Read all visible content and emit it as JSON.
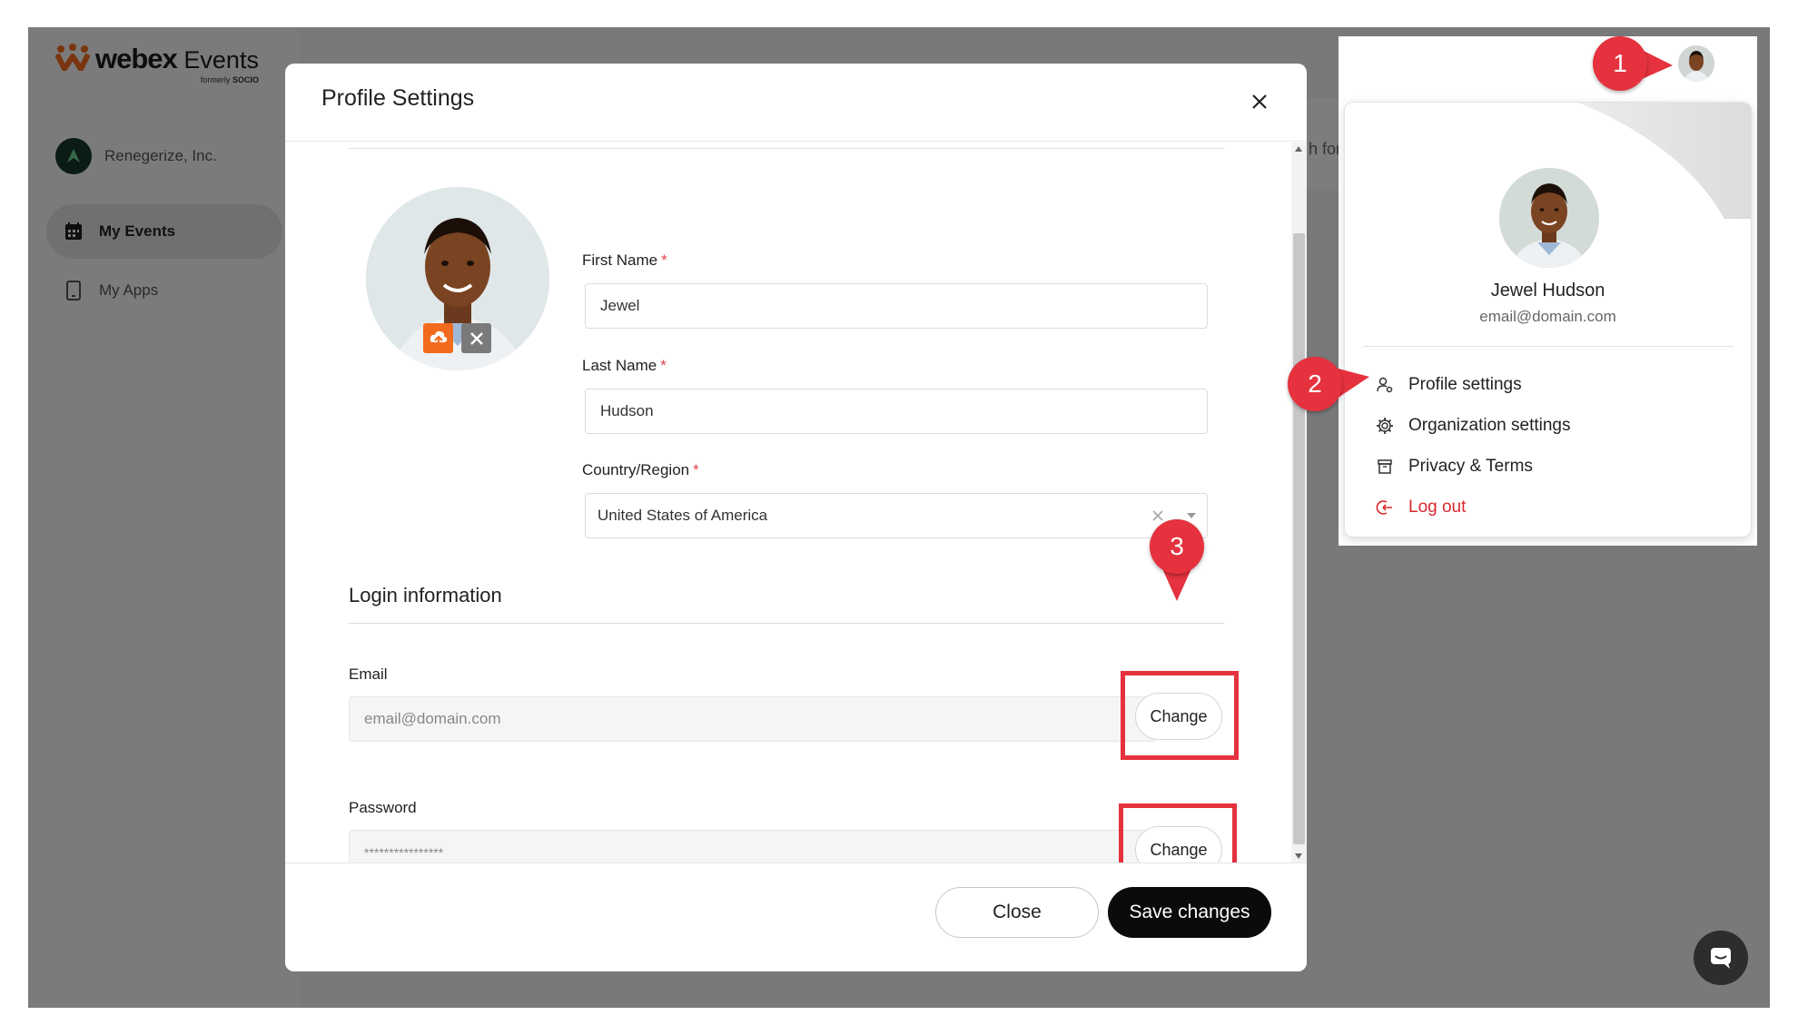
{
  "app": {
    "logo_main": "webex",
    "logo_events": "Events",
    "logo_sub_prefix": "formerly",
    "logo_sub_brand": "SOCIO",
    "org_name": "Renegerize, Inc.",
    "nav": [
      {
        "label": "My Events",
        "icon": "calendar-icon",
        "active": true
      },
      {
        "label": "My Apps",
        "icon": "tablet-icon",
        "active": false
      }
    ],
    "search_ghost": "h for"
  },
  "modal": {
    "title": "Profile Settings",
    "first_name_label": "First Name",
    "first_name_value": "Jewel",
    "last_name_label": "Last Name",
    "last_name_value": "Hudson",
    "country_label": "Country/Region",
    "country_value": "United States of America",
    "required_mark": "*",
    "login_section_title": "Login information",
    "email_label": "Email",
    "email_placeholder": "email@domain.com",
    "password_label": "Password",
    "password_placeholder": "****************",
    "change_label": "Change",
    "close_label": "Close",
    "save_label": "Save changes"
  },
  "user_menu": {
    "name": "Jewel Hudson",
    "email": "email@domain.com",
    "items": [
      {
        "label": "Profile settings",
        "icon": "user-settings-icon"
      },
      {
        "label": "Organization settings",
        "icon": "gear-icon"
      },
      {
        "label": "Privacy & Terms",
        "icon": "archive-icon"
      },
      {
        "label": "Log out",
        "icon": "logout-icon"
      }
    ]
  },
  "callouts": [
    "1",
    "2",
    "3"
  ],
  "colors": {
    "accent_red": "#e5323e",
    "upload_orange": "#f26b1d",
    "primary_dark": "#0b0b0b"
  }
}
